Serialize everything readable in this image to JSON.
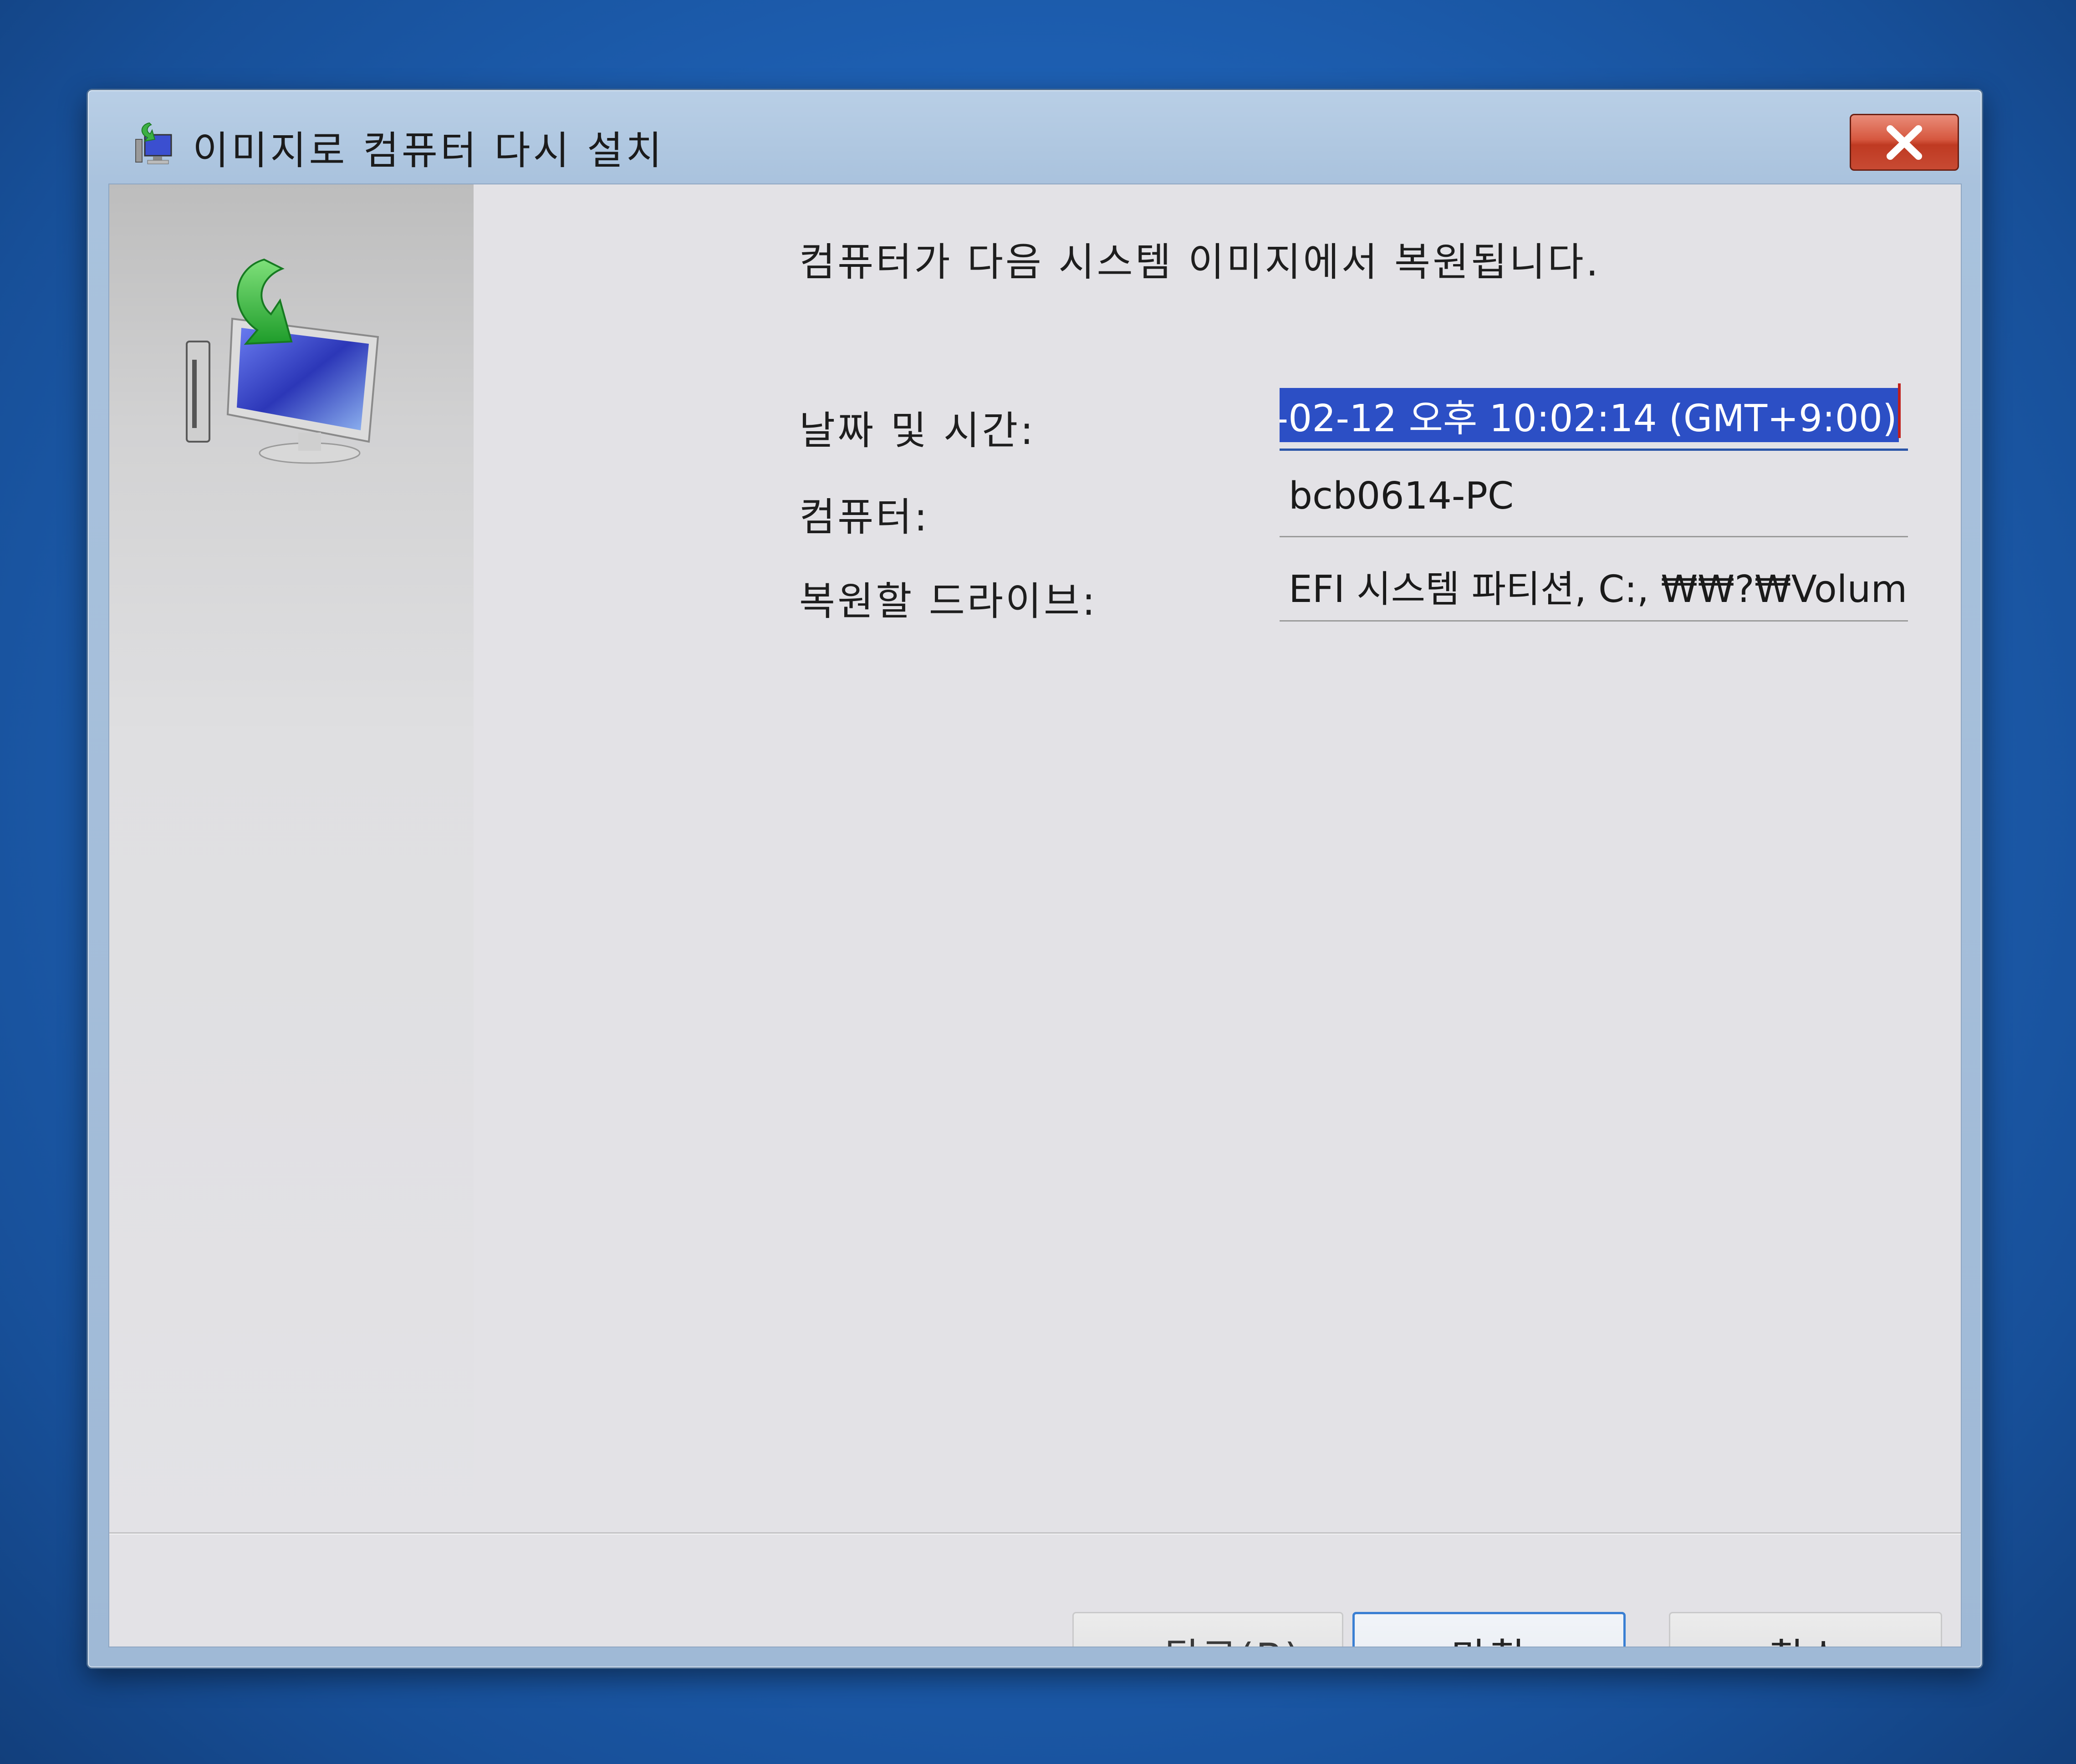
{
  "window": {
    "title": "이미지로 컴퓨터 다시 설치",
    "title_icon": "reimage-computer-icon",
    "close_icon": "close-icon"
  },
  "content": {
    "heading": "컴퓨터가 다음 시스템 이미지에서 복원됩니다.",
    "rows": [
      {
        "label": "날짜 및 시간:",
        "value": "-02-12 오후 10:02:14 (GMT+9:00)"
      },
      {
        "label": "컴퓨터:",
        "value": "bcb0614-PC"
      },
      {
        "label": "복원할 드라이브:",
        "value": "EFI 시스템 파티션, C:, ₩₩?₩Volum"
      }
    ]
  },
  "buttons": {
    "back": "< 뒤로(B)",
    "finish": "마침",
    "cancel": "취소"
  },
  "colors": {
    "selection": "#2c4fc5",
    "close_button": "#c84a33",
    "annotation": "#d0201d",
    "desktop": "#1f63b8"
  }
}
